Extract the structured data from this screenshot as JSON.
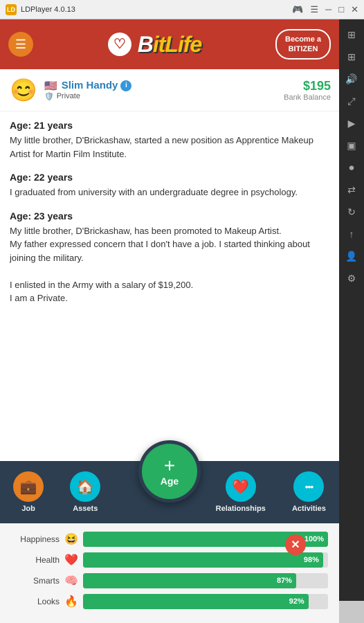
{
  "titleBar": {
    "appName": "LDPlayer 4.0.13",
    "controls": [
      "gamepad",
      "menu",
      "minimize",
      "maximize",
      "close"
    ]
  },
  "header": {
    "menuLabel": "☰",
    "logoText": "BitLife",
    "bitizen": {
      "line1": "Become a",
      "line2": "BITIZEN"
    }
  },
  "profile": {
    "name": "Slim Handy",
    "rank": "Private",
    "balance": "$195",
    "balanceLabel": "Bank Balance"
  },
  "ageEntries": [
    {
      "age": "Age: 21 years",
      "text": "My little brother, D'Brickashaw, started a new position as Apprentice Makeup Artist for Martin Film Institute."
    },
    {
      "age": "Age: 22 years",
      "text": "I graduated from university with an undergraduate degree in psychology."
    },
    {
      "age": "Age: 23 years",
      "text": "My little brother, D'Brickashaw, has been promoted to Makeup Artist.\nMy father expressed concern that I don't have a job. I started thinking about joining the military.\n\nI enlisted in the Army with a salary of $19,200.\nI am a Private."
    }
  ],
  "nav": {
    "items": [
      {
        "id": "job",
        "label": "Job",
        "emoji": "💼"
      },
      {
        "id": "assets",
        "label": "Assets",
        "emoji": "🏠"
      },
      {
        "id": "age",
        "label": "Age",
        "plus": "+"
      },
      {
        "id": "relationships",
        "label": "Relationships",
        "emoji": "❤️"
      },
      {
        "id": "activities",
        "label": "Activities",
        "emoji": "···"
      }
    ]
  },
  "stats": [
    {
      "label": "Happiness",
      "emoji": "😆",
      "value": 100,
      "display": "100%"
    },
    {
      "label": "Health",
      "emoji": "❤️",
      "value": 98,
      "display": "98%"
    },
    {
      "label": "Smarts",
      "emoji": "🧠",
      "value": 87,
      "display": "87%"
    },
    {
      "label": "Looks",
      "emoji": "🔥",
      "value": 92,
      "display": "92%"
    }
  ],
  "colors": {
    "headerRed": "#c0392b",
    "navDark": "#2c3e50",
    "green": "#27ae60",
    "teal": "#00bcd4",
    "orange": "#e67e22"
  }
}
